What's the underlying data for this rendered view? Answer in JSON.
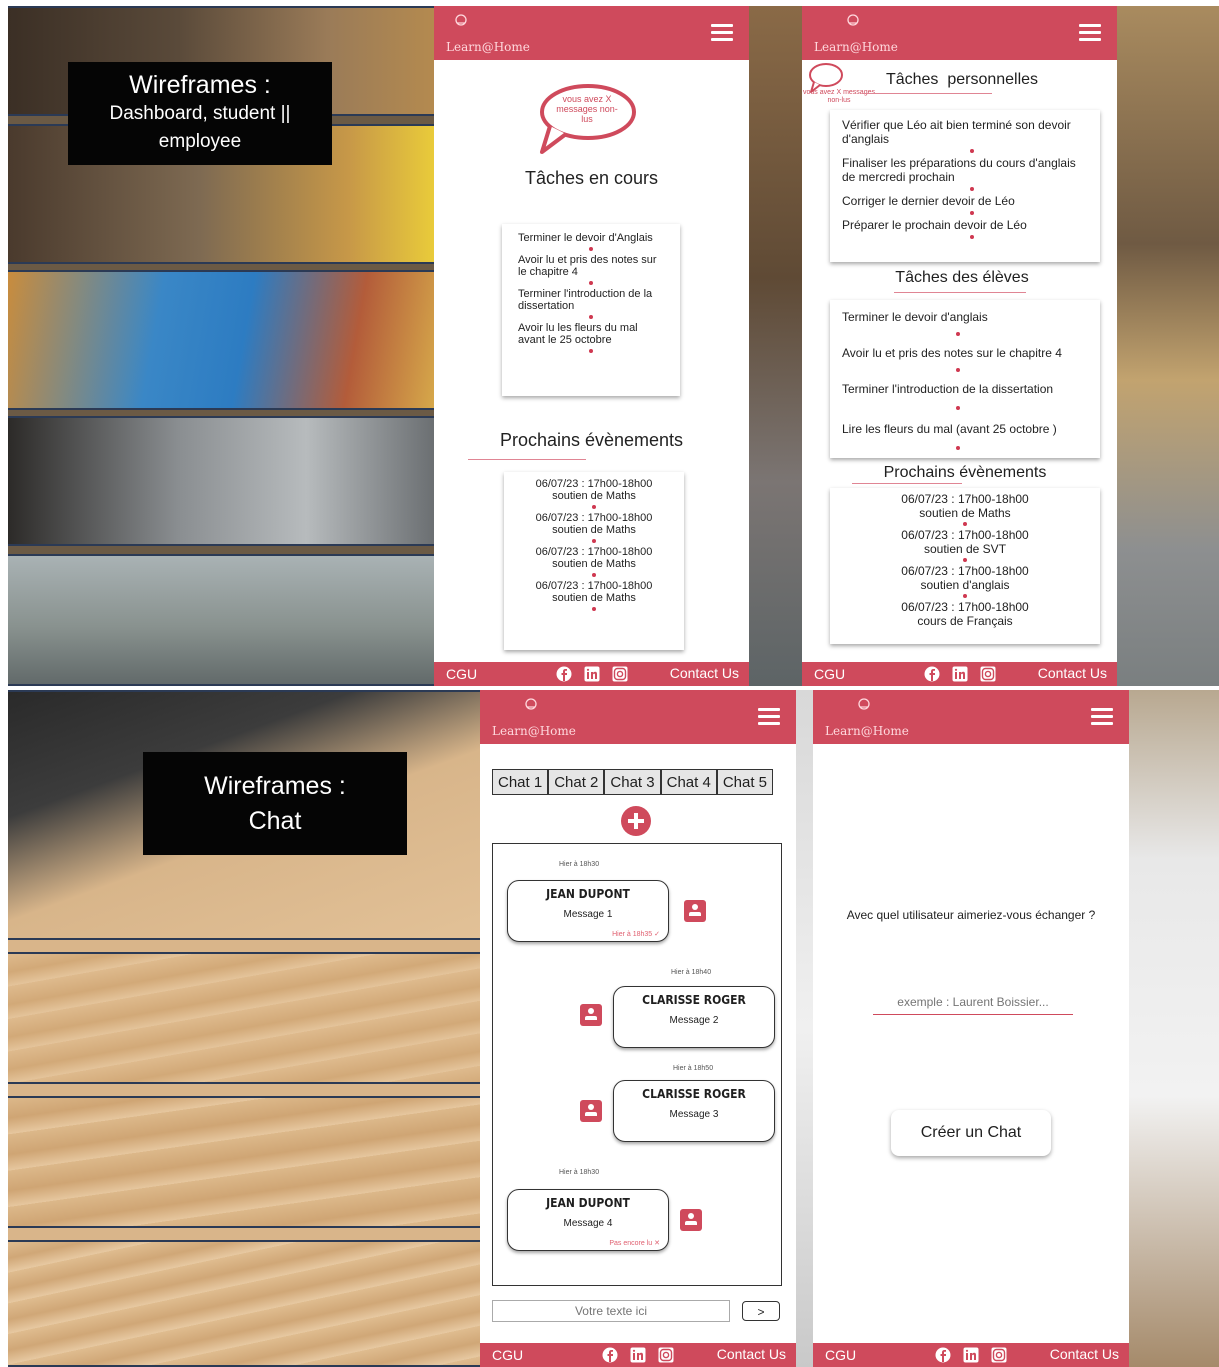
{
  "colors": {
    "brand": "#cf4a5c",
    "brand_light": "#e08594",
    "dot": "#cf3850",
    "label_bg": "#050505"
  },
  "labels": {
    "dashboard": {
      "title": "Wireframes :",
      "subtitle": "Dashboard, student || employee"
    },
    "chat": {
      "title": "Wireframes :",
      "subtitle": "Chat"
    }
  },
  "app": {
    "logo_text": "Learn@Home",
    "footer": {
      "cgu": "CGU",
      "contact": "Contact Us",
      "icons": [
        "facebook-icon",
        "linkedin-icon",
        "instagram-icon"
      ]
    }
  },
  "student": {
    "unread_bubble": "vous avez X messages non-lus",
    "tasks_title": "Tâches en cours",
    "tasks": [
      "Terminer le devoir d'Anglais",
      "Avoir lu et pris des notes sur le chapitre 4",
      "Terminer l'introduction de la dissertation",
      "Avoir lu les fleurs du mal avant le 25 octobre"
    ],
    "events_title": "Prochains évènements",
    "events": [
      {
        "date": "06/07/23 : 17h00-18h00",
        "label": "soutien de Maths"
      },
      {
        "date": "06/07/23 : 17h00-18h00",
        "label": "soutien de Maths"
      },
      {
        "date": "06/07/23 : 17h00-18h00",
        "label": "soutien de Maths"
      },
      {
        "date": "06/07/23 : 17h00-18h00",
        "label": "soutien de Maths"
      }
    ]
  },
  "employee": {
    "unread_bubble": "vous avez X messages non-lus",
    "personal_title": "Tâches  personnelles",
    "personal_tasks": [
      "Vérifier que Léo ait bien terminé son devoir d'anglais",
      "Finaliser les préparations du cours d'anglais de mercredi prochain",
      "Corriger le dernier devoir de Léo",
      "Préparer le prochain devoir de Léo"
    ],
    "students_title": "Tâches des élèves",
    "student_tasks": [
      "Terminer le devoir d'anglais",
      "Avoir lu et pris des notes sur le chapitre 4",
      "Terminer l'introduction de la dissertation",
      "Lire les fleurs du mal (avant 25 octobre )"
    ],
    "events_title": "Prochains évènements",
    "events": [
      {
        "date": "06/07/23 : 17h00-18h00",
        "label": "soutien de Maths"
      },
      {
        "date": "06/07/23 : 17h00-18h00",
        "label": "soutien de SVT"
      },
      {
        "date": "06/07/23 : 17h00-18h00",
        "label": "soutien d'anglais"
      },
      {
        "date": "06/07/23 : 17h00-18h00",
        "label": "cours de Français"
      }
    ]
  },
  "chat": {
    "tabs": [
      "Chat 1",
      "Chat 2",
      "Chat 3",
      "Chat 4",
      "Chat 5"
    ],
    "messages": [
      {
        "stamp": "Hier à 18h30",
        "name": "JEAN DUPONT",
        "text": "Message 1",
        "status": "Hier à 18h35 ✓"
      },
      {
        "stamp": "Hier à 18h40",
        "name": "CLARISSE ROGER",
        "text": "Message 2",
        "status": ""
      },
      {
        "stamp": "Hier à 18h50",
        "name": "CLARISSE ROGER",
        "text": "Message 3",
        "status": ""
      },
      {
        "stamp": "Hier à 18h30",
        "name": "JEAN DUPONT",
        "text": "Message 4",
        "status": "Pas encore lu ✕"
      }
    ],
    "input_placeholder": "Votre texte ici",
    "send_label": ">"
  },
  "new_chat": {
    "question": "Avec quel utilisateur aimeriez-vous échanger ?",
    "input_placeholder": "exemple : Laurent Boissier...",
    "create_label": "Créer un Chat"
  }
}
